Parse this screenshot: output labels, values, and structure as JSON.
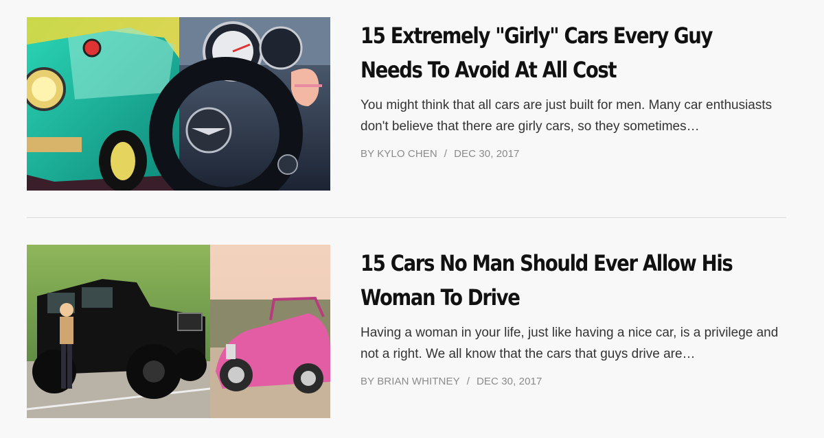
{
  "articles": [
    {
      "title": "15 Extremely \"Girly\" Cars Every Guy Needs To Avoid At All Cost",
      "excerpt": "You might think that all cars are just built for men. Many car enthusiasts don't believe that there are girly cars, so they sometimes…",
      "author": "BY KYLO CHEN",
      "separator": "/",
      "date": "DEC 30, 2017",
      "image": "mint-green-mini-and-mini-steering-wheel-collage"
    },
    {
      "title": "15 Cars No Man Should Ever Allow His Woman To Drive",
      "excerpt": "Having a woman in your life, just like having a nice car, is a privilege and not a right. We all know that the cars that guys drive are…",
      "author": "BY BRIAN WHITNEY",
      "separator": "/",
      "date": "DEC 30, 2017",
      "image": "black-hummer-and-pink-beetle-collage"
    }
  ],
  "colors": {
    "background": "#f8f8f8",
    "title": "#111111",
    "excerpt": "#333333",
    "meta": "#8a8a8a",
    "divider": "#dcdcdc"
  }
}
